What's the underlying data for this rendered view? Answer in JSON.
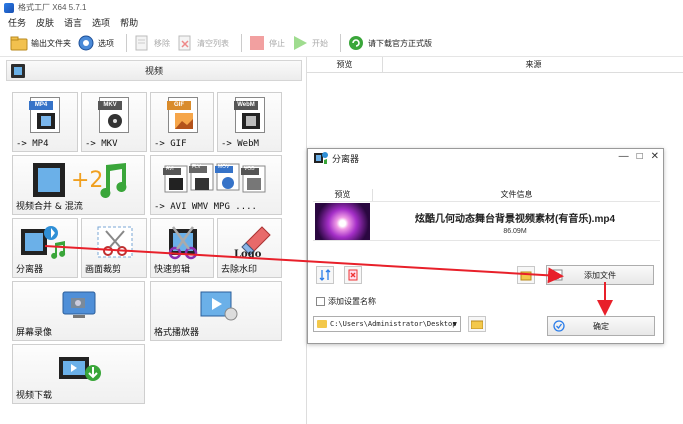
{
  "app": {
    "title": "格式工厂 X64 5.7.1"
  },
  "menu": [
    "任务",
    "皮肤",
    "语言",
    "选项",
    "帮助"
  ],
  "toolbar": {
    "output_folder": "输出文件夹",
    "options": "选项",
    "remove": "移除",
    "clear_list": "清空列表",
    "stop": "停止",
    "start": "开始",
    "download": "请下载官方正式版"
  },
  "category": {
    "label": "视频"
  },
  "tiles": [
    {
      "label": "-> MP4"
    },
    {
      "label": "-> MKV"
    },
    {
      "label": "-> GIF"
    },
    {
      "label": "-> WebM"
    },
    {
      "label": "视频合并 & 混流"
    },
    {
      "label": "-> AVI WMV MPG ...."
    },
    {
      "label": "分离器"
    },
    {
      "label": "画面裁剪"
    },
    {
      "label": "快速剪辑"
    },
    {
      "label": "去除水印"
    },
    {
      "label": "屏幕录像"
    },
    {
      "label": "格式播放器"
    },
    {
      "label": "视频下载"
    }
  ],
  "format_badges": {
    "mp4": "MP4",
    "mkv": "MKV",
    "gif": "GIF",
    "webm": "WebM",
    "avi": "AVI",
    "flv": "FLV",
    "mov": "MOV",
    "vob": "VOB"
  },
  "logo_text": "Logo",
  "right_columns": {
    "preview": "预览",
    "source": "来源"
  },
  "dialog": {
    "title": "分离器",
    "col_preview": "预览",
    "col_info": "文件信息",
    "file_name": "炫酷几何动态舞台背景视频素材(有音乐).mp4",
    "file_size": "86.09M",
    "add_file": "添加文件",
    "add_name_label": "添加设置名称",
    "path": "C:\\Users\\Administrator\\Desktop",
    "ok": "确定"
  },
  "colors": {
    "annotation_red": "#e8202a",
    "accent_blue": "#2b7de9"
  }
}
